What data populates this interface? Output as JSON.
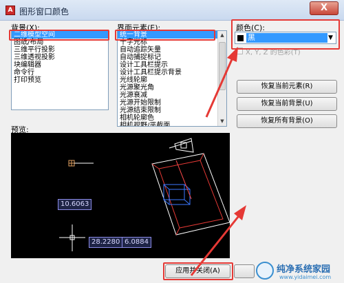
{
  "window": {
    "title": "图形窗口颜色",
    "close_glyph": "X"
  },
  "context": {
    "label": "背景(X):",
    "items": [
      "二维模型空间",
      "图纸/布局",
      "三维平行投影",
      "三维透视投影",
      "块编辑器",
      "命令行",
      "打印预览"
    ],
    "selected_index": 0
  },
  "element": {
    "label": "界面元素(E):",
    "items": [
      "统一背景",
      "十字光标",
      "自动追踪矢量",
      "自动捕捉标记",
      "设计工具栏提示",
      "设计工具栏提示背景",
      "光线轮廓",
      "光源聚光角",
      "光源衰减",
      "光源开始限制",
      "光源结束限制",
      "相机轮廓色",
      "相机视野/平截面"
    ],
    "selected_index": 0
  },
  "color": {
    "label": "颜色(C):",
    "value": "黑",
    "swatch": "#000000",
    "tint_label": "X, Y, Z 的色彩(T)"
  },
  "buttons": {
    "restore_element": "恢复当前元素(R)",
    "restore_context": "恢复当前背景(U)",
    "restore_all": "恢复所有背景(O)",
    "apply_close": "应用并关闭(A)"
  },
  "preview": {
    "label": "预览:",
    "coord_distance": "10.6063",
    "coord_x": "28.2280",
    "coord_y": "6.0884"
  },
  "watermark": {
    "brand": "纯净系统家园",
    "url": "www.yidaimei.com"
  },
  "colors": {
    "selection": "#3399ff",
    "highlight": "#e53935",
    "preview_bg": "#000000"
  }
}
